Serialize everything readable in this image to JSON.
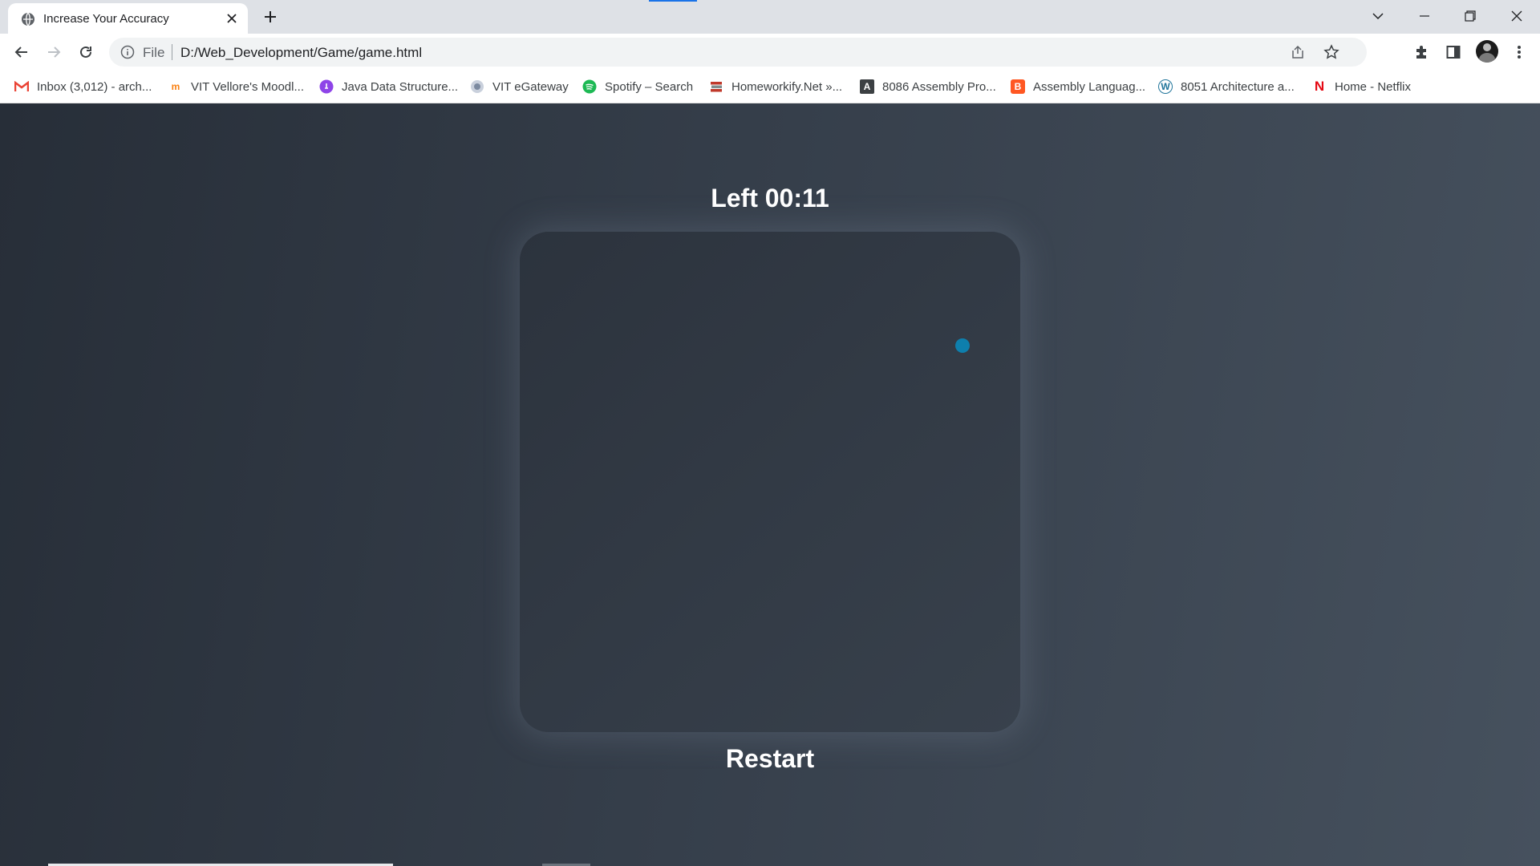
{
  "browser": {
    "tab_title": "Increase Your Accuracy",
    "url_scheme": "File",
    "url": "D:/Web_Development/Game/game.html"
  },
  "bookmarks": [
    {
      "label": "Inbox (3,012) - arch...",
      "icon": "gmail-icon",
      "color": "#ea4335"
    },
    {
      "label": "VIT Vellore's Moodl...",
      "icon": "moodle-icon",
      "color": "#f98012"
    },
    {
      "label": "Java Data Structure...",
      "icon": "java-icon",
      "color": "#8e44e8"
    },
    {
      "label": "VIT eGateway",
      "icon": "vit-icon",
      "color": "#7c8aa0"
    },
    {
      "label": "Spotify – Search",
      "icon": "spotify-icon",
      "color": "#1db954"
    },
    {
      "label": "Homeworkify.Net »...",
      "icon": "books-icon",
      "color": "#c0392b"
    },
    {
      "label": "8086 Assembly Pro...",
      "icon": "letter-a-icon",
      "color": "#3c4043"
    },
    {
      "label": "Assembly Languag...",
      "icon": "blogger-icon",
      "color": "#ff5722"
    },
    {
      "label": "8051 Architecture a...",
      "icon": "wordpress-icon",
      "color": "#21759b"
    },
    {
      "label": "Home - Netflix",
      "icon": "netflix-icon",
      "color": "#e50914"
    }
  ],
  "game": {
    "timer_text": "Left 00:11",
    "restart_label": "Restart",
    "target_color": "#0e7fad"
  }
}
